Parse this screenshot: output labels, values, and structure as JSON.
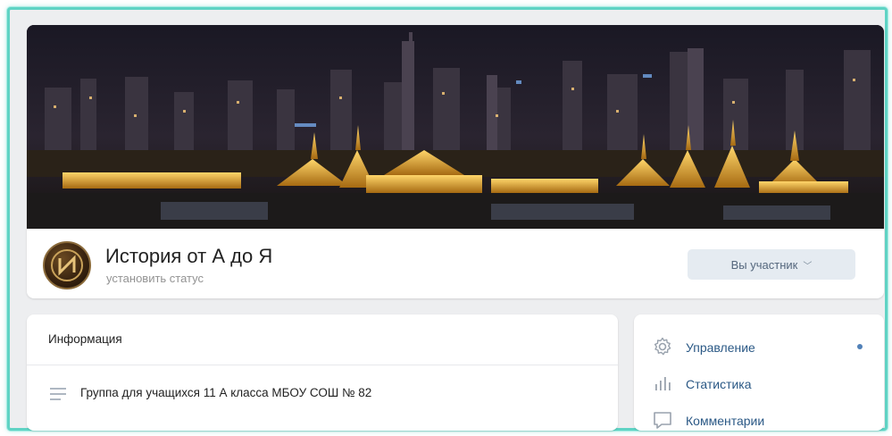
{
  "group": {
    "title": "История от А до Я",
    "status_placeholder": "установить статус",
    "member_button": "Вы участник",
    "member_chevron": "﹀"
  },
  "info": {
    "heading": "Информация",
    "description": "Группа для учащихся 11 А класса МБОУ СОШ № 82"
  },
  "menu": {
    "items": [
      {
        "label": "Управление",
        "icon": "gear-icon",
        "has_dot": true
      },
      {
        "label": "Статистика",
        "icon": "stats-icon",
        "has_dot": false
      },
      {
        "label": "Комментарии",
        "icon": "comment-icon",
        "has_dot": false
      }
    ]
  },
  "colors": {
    "accent": "#5181b8",
    "link": "#2a5885",
    "frame": "#5fd3c4",
    "page_bg": "#edeef0"
  }
}
